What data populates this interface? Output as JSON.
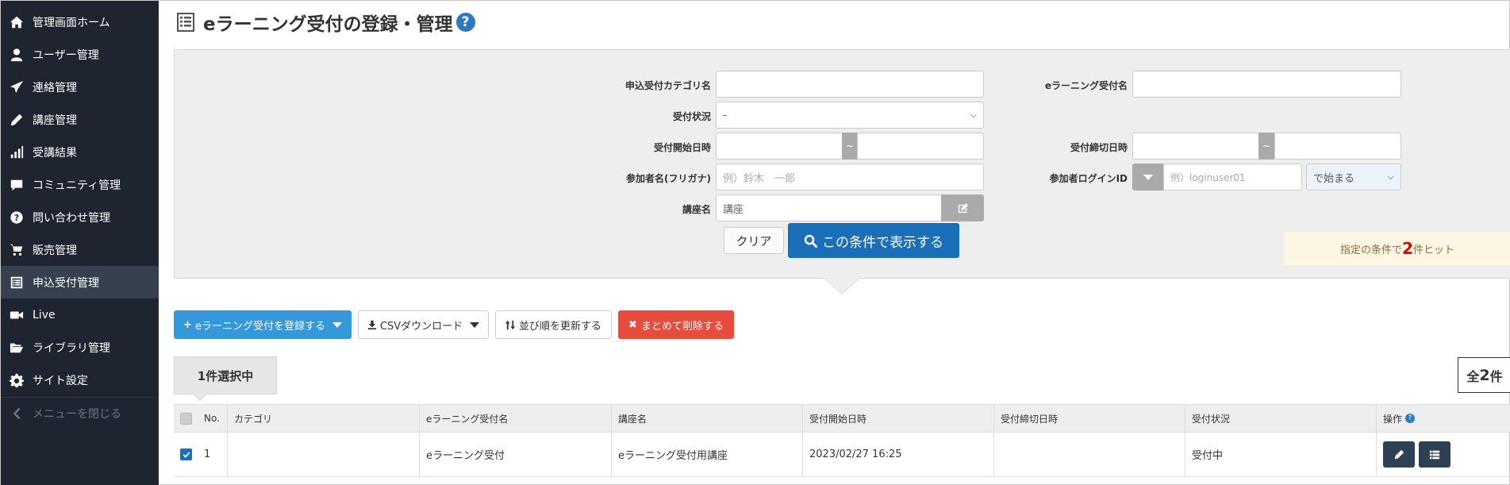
{
  "sidebar": {
    "items": [
      {
        "label": "管理画面ホーム",
        "icon": "home-icon"
      },
      {
        "label": "ユーザー管理",
        "icon": "user-icon"
      },
      {
        "label": "連絡管理",
        "icon": "paper-plane-icon"
      },
      {
        "label": "講座管理",
        "icon": "pencil-icon"
      },
      {
        "label": "受講結果",
        "icon": "bar-chart-icon"
      },
      {
        "label": "コミュニティ管理",
        "icon": "comment-icon"
      },
      {
        "label": "問い合わせ管理",
        "icon": "question-circle-icon"
      },
      {
        "label": "販売管理",
        "icon": "cart-icon"
      },
      {
        "label": "申込受付管理",
        "icon": "list-alt-icon"
      },
      {
        "label": "Live",
        "icon": "video-camera-icon"
      },
      {
        "label": "ライブラリ管理",
        "icon": "folder-open-icon"
      },
      {
        "label": "サイト設定",
        "icon": "gear-icon"
      }
    ],
    "collapse_label": "メニューを閉じる"
  },
  "header": {
    "title": "eラーニング受付の登録・管理",
    "help": "?"
  },
  "search": {
    "category_label": "申込受付カテゴリ名",
    "category_value": "",
    "name_label": "eラーニング受付名",
    "name_value": "",
    "status_label": "受付状況",
    "status_value": "-",
    "start_label": "受付開始日時",
    "end_label": "受付締切日時",
    "range_sep": "~",
    "kana_label": "参加者名(フリガナ)",
    "kana_placeholder": "例）鈴木　一郎",
    "login_label": "参加者ログインID",
    "login_placeholder": "例）loginuser01",
    "match_value": "で始まる",
    "course_label": "講座名",
    "course_placeholder": "講座",
    "clear_label": "クリア",
    "submit_label": "この条件で表示する",
    "hits_prefix": "指定の条件で",
    "hits_count": "2",
    "hits_suffix": "件ヒット"
  },
  "toolbar": {
    "register_label": "eラーニング受付を登録する",
    "csv_label": "CSVダウンロード",
    "sort_label": "並び順を更新する",
    "bulk_delete_label": "まとめて削除する"
  },
  "selection": {
    "selected_text": "1件選択中",
    "total_prefix": "全",
    "total_count": "2",
    "total_suffix": "件"
  },
  "table": {
    "headers": {
      "no": "No.",
      "category": "カテゴリ",
      "name": "eラーニング受付名",
      "course": "講座名",
      "start": "受付開始日時",
      "end": "受付締切日時",
      "status": "受付状況",
      "ops": "操作"
    },
    "rows": [
      {
        "no": "1",
        "category": "",
        "name": "eラーニング受付",
        "course": "eラーニング受付用講座",
        "start": "2023/02/27 16:25",
        "end": "",
        "status": "受付中",
        "checked": true
      }
    ]
  },
  "colors": {
    "sidebar_bg": "#1e2430",
    "sidebar_active": "#36404f",
    "primary": "#1a6fb8",
    "register_blue": "#3498db",
    "danger": "#e74c3c",
    "hit_red": "#e20000"
  }
}
